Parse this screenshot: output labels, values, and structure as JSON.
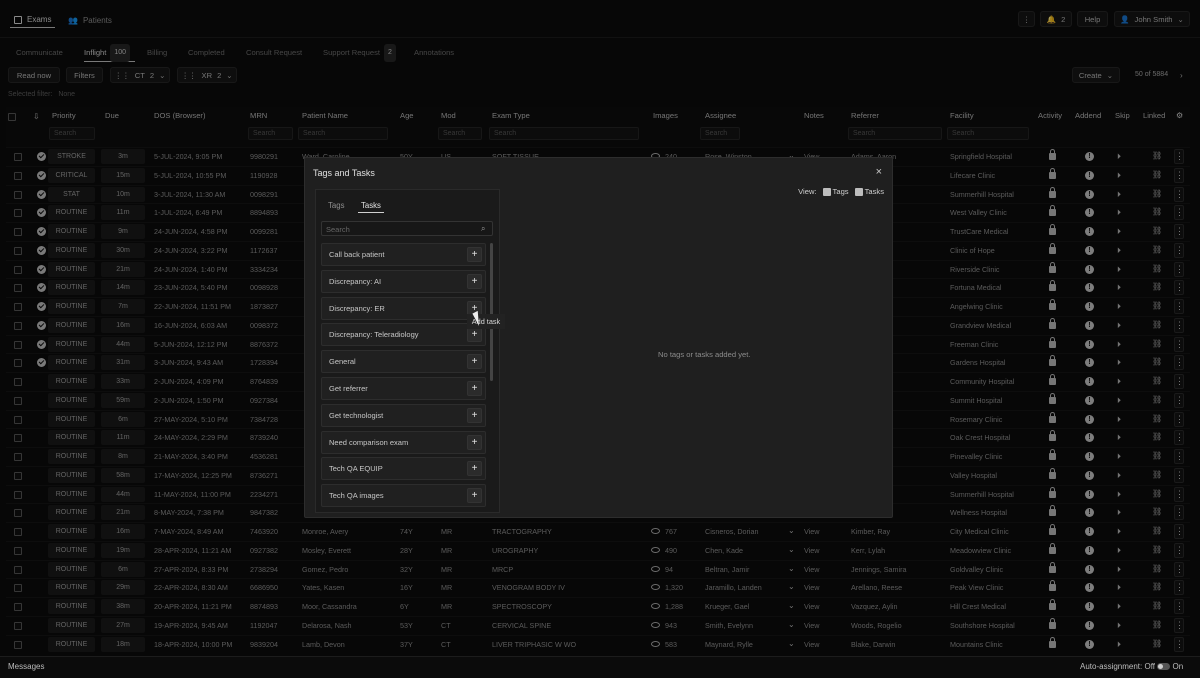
{
  "header": {
    "exams_label": "Exams",
    "patients_label": "Patients",
    "notifications_count": "2",
    "help_label": "Help",
    "user_label": "John Smith"
  },
  "subtabs": [
    {
      "label": "Communicate"
    },
    {
      "label": "Inflight",
      "count": "100"
    },
    {
      "label": "Billing"
    },
    {
      "label": "Completed"
    },
    {
      "label": "Consult Request"
    },
    {
      "label": "Support Request",
      "count": "2"
    },
    {
      "label": "Annotations"
    }
  ],
  "toolbar": {
    "read_now": "Read now",
    "filters": "Filters",
    "ct_label": "CT",
    "ct_count": "2",
    "xr_label": "XR",
    "xr_count": "2",
    "selected_filter_label": "Selected filter:",
    "selected_filter_value": "None",
    "create_label": "Create",
    "pagination": "50 of 5884"
  },
  "columns": [
    "Priority",
    "Due",
    "DOS (Browser)",
    "MRN",
    "Patient Name",
    "Age",
    "Mod",
    "Exam Type",
    "Images",
    "Assignee",
    "Notes",
    "Referrer",
    "Facility",
    "Activity",
    "Addend",
    "Skip",
    "Linked"
  ],
  "search_placeholder": "Search",
  "rows": [
    {
      "priority": "STROKE",
      "due": "3m",
      "dos": "5-JUL-2024, 9:05 PM",
      "mrn": "9980291",
      "patient": "Ward, Caroline",
      "age": "50Y",
      "mod": "US",
      "exam": "SOFT TISSUE",
      "images": "240",
      "assignee": "Rose, Winston",
      "notes": "View",
      "referrer": "Adams, Aaron",
      "facility": "Springfield Hospital",
      "done": true
    },
    {
      "priority": "CRITICAL",
      "due": "15m",
      "dos": "5-JUL-2024, 10:55 PM",
      "mrn": "1190928",
      "patient": "",
      "age": "",
      "mod": "",
      "exam": "",
      "images": "",
      "assignee": "",
      "notes": "",
      "referrer": "",
      "facility": "Lifecare Clinic",
      "done": true
    },
    {
      "priority": "STAT",
      "due": "10m",
      "dos": "3-JUL-2024, 11:30 AM",
      "mrn": "0098291",
      "patient": "",
      "age": "",
      "mod": "",
      "exam": "",
      "images": "",
      "assignee": "",
      "notes": "",
      "referrer": "ex",
      "facility": "Summerhill Hospital",
      "done": true
    },
    {
      "priority": "ROUTINE",
      "due": "11m",
      "dos": "1-JUL-2024, 6:49 PM",
      "mrn": "8894893",
      "patient": "",
      "age": "",
      "mod": "",
      "exam": "",
      "images": "",
      "assignee": "",
      "notes": "",
      "referrer": "ann",
      "facility": "West Valley Clinic",
      "done": true
    },
    {
      "priority": "ROUTINE",
      "due": "9m",
      "dos": "24-JUN-2024, 4:58 PM",
      "mrn": "0099281",
      "patient": "",
      "age": "",
      "mod": "",
      "exam": "",
      "images": "",
      "assignee": "",
      "notes": "",
      "referrer": "alani",
      "facility": "TrustCare Medical",
      "done": true
    },
    {
      "priority": "ROUTINE",
      "due": "30m",
      "dos": "24-JUN-2024, 3:22 PM",
      "mrn": "1172637",
      "patient": "",
      "age": "",
      "mod": "",
      "exam": "",
      "images": "",
      "assignee": "",
      "notes": "",
      "referrer": "ana",
      "facility": "Clinic of Hope",
      "done": true
    },
    {
      "priority": "ROUTINE",
      "due": "21m",
      "dos": "24-JUN-2024, 1:40 PM",
      "mrn": "3334234",
      "patient": "",
      "age": "",
      "mod": "",
      "exam": "",
      "images": "",
      "assignee": "",
      "notes": "",
      "referrer": "ate",
      "facility": "Riverside Clinic",
      "done": true
    },
    {
      "priority": "ROUTINE",
      "due": "14m",
      "dos": "23-JUN-2024, 5:40 PM",
      "mrn": "0098928",
      "patient": "",
      "age": "",
      "mod": "",
      "exam": "",
      "images": "",
      "assignee": "",
      "notes": "",
      "referrer": "",
      "facility": "Fortuna Medical",
      "done": true
    },
    {
      "priority": "ROUTINE",
      "due": "7m",
      "dos": "22-JUN-2024, 11:51 PM",
      "mrn": "1873827",
      "patient": "",
      "age": "",
      "mod": "",
      "exam": "",
      "images": "",
      "assignee": "",
      "notes": "",
      "referrer": "o",
      "facility": "Angelwing Clinic",
      "done": true
    },
    {
      "priority": "ROUTINE",
      "due": "16m",
      "dos": "16-JUN-2024, 6:03 AM",
      "mrn": "0098372",
      "patient": "",
      "age": "",
      "mod": "",
      "exam": "",
      "images": "",
      "assignee": "",
      "notes": "",
      "referrer": "",
      "facility": "Grandview Medical",
      "done": true
    },
    {
      "priority": "ROUTINE",
      "due": "44m",
      "dos": "5-JUN-2024, 12:12 PM",
      "mrn": "8876372",
      "patient": "",
      "age": "",
      "mod": "",
      "exam": "",
      "images": "",
      "assignee": "",
      "notes": "",
      "referrer": "emis",
      "facility": "Freeman Clinic",
      "done": true
    },
    {
      "priority": "ROUTINE",
      "due": "31m",
      "dos": "3-JUN-2024, 9:43 AM",
      "mrn": "1728394",
      "patient": "",
      "age": "",
      "mod": "",
      "exam": "",
      "images": "",
      "assignee": "",
      "notes": "",
      "referrer": "ha",
      "facility": "Gardens Hospital",
      "done": true
    },
    {
      "priority": "ROUTINE",
      "due": "33m",
      "dos": "2-JUN-2024, 4:09 PM",
      "mrn": "8764839",
      "patient": "",
      "age": "",
      "mod": "",
      "exam": "",
      "images": "",
      "assignee": "",
      "notes": "",
      "referrer": "",
      "facility": "Community Hospital",
      "done": false
    },
    {
      "priority": "ROUTINE",
      "due": "59m",
      "dos": "2-JUN-2024, 1:50 PM",
      "mrn": "0927384",
      "patient": "",
      "age": "",
      "mod": "",
      "exam": "",
      "images": "",
      "assignee": "",
      "notes": "",
      "referrer": "ensen",
      "facility": "Summit Hospital",
      "done": false
    },
    {
      "priority": "ROUTINE",
      "due": "6m",
      "dos": "27-MAY-2024, 5:10 PM",
      "mrn": "7384728",
      "patient": "",
      "age": "",
      "mod": "",
      "exam": "",
      "images": "",
      "assignee": "",
      "notes": "",
      "referrer": "n",
      "facility": "Rosemary Clinic",
      "done": false
    },
    {
      "priority": "ROUTINE",
      "due": "11m",
      "dos": "24-MAY-2024, 2:29 PM",
      "mrn": "8739240",
      "patient": "",
      "age": "",
      "mod": "",
      "exam": "",
      "images": "",
      "assignee": "",
      "notes": "",
      "referrer": "ton",
      "facility": "Oak Crest Hospital",
      "done": false
    },
    {
      "priority": "ROUTINE",
      "due": "8m",
      "dos": "21-MAY-2024, 3:40 PM",
      "mrn": "4536281",
      "patient": "",
      "age": "",
      "mod": "",
      "exam": "",
      "images": "",
      "assignee": "",
      "notes": "",
      "referrer": "elio",
      "facility": "Pinevalley Clinic",
      "done": false
    },
    {
      "priority": "ROUTINE",
      "due": "58m",
      "dos": "17-MAY-2024, 12:25 PM",
      "mrn": "8736271",
      "patient": "",
      "age": "",
      "mod": "",
      "exam": "",
      "images": "",
      "assignee": "",
      "notes": "",
      "referrer": "Joel",
      "facility": "Valley Hospital",
      "done": false
    },
    {
      "priority": "ROUTINE",
      "due": "44m",
      "dos": "11-MAY-2024, 11:00 PM",
      "mrn": "2234271",
      "patient": "",
      "age": "",
      "mod": "",
      "exam": "",
      "images": "",
      "assignee": "",
      "notes": "",
      "referrer": "",
      "facility": "Summerhill Hospital",
      "done": false
    },
    {
      "priority": "ROUTINE",
      "due": "21m",
      "dos": "8-MAY-2024, 7:38 PM",
      "mrn": "9847382",
      "patient": "",
      "age": "",
      "mod": "",
      "exam": "",
      "images": "",
      "assignee": "",
      "notes": "",
      "referrer": "",
      "facility": "Wellness Hospital",
      "done": false
    },
    {
      "priority": "ROUTINE",
      "due": "16m",
      "dos": "7-MAY-2024, 8:49 AM",
      "mrn": "7463920",
      "patient": "Monroe, Avery",
      "age": "74Y",
      "mod": "MR",
      "exam": "TRACTOGRAPHY",
      "images": "767",
      "assignee": "Cisneros, Dorian",
      "notes": "View",
      "referrer": "Kimber, Ray",
      "facility": "City Medical Clinic",
      "done": false
    },
    {
      "priority": "ROUTINE",
      "due": "19m",
      "dos": "28-APR-2024, 11:21 AM",
      "mrn": "0927382",
      "patient": "Mosley, Everett",
      "age": "28Y",
      "mod": "MR",
      "exam": "UROGRAPHY",
      "images": "490",
      "assignee": "Chen, Kade",
      "notes": "View",
      "referrer": "Kerr, Lylah",
      "facility": "Meadowview Clinic",
      "done": false
    },
    {
      "priority": "ROUTINE",
      "due": "6m",
      "dos": "27-APR-2024, 8:33 PM",
      "mrn": "2738294",
      "patient": "Gomez, Pedro",
      "age": "32Y",
      "mod": "MR",
      "exam": "MRCP",
      "images": "94",
      "assignee": "Beltran, Jamir",
      "notes": "View",
      "referrer": "Jennings, Samira",
      "facility": "Goldvalley Clinic",
      "done": false
    },
    {
      "priority": "ROUTINE",
      "due": "29m",
      "dos": "22-APR-2024, 8:30 AM",
      "mrn": "6686950",
      "patient": "Yates, Kasen",
      "age": "16Y",
      "mod": "MR",
      "exam": "VENOGRAM BODY IV",
      "images": "1,320",
      "assignee": "Jaramillo, Landen",
      "notes": "View",
      "referrer": "Arellano, Reese",
      "facility": "Peak View Clinic",
      "done": false
    },
    {
      "priority": "ROUTINE",
      "due": "38m",
      "dos": "20-APR-2024, 11:21 PM",
      "mrn": "8874893",
      "patient": "Moor, Cassandra",
      "age": "6Y",
      "mod": "MR",
      "exam": "SPECTROSCOPY",
      "images": "1,288",
      "assignee": "Krueger, Gael",
      "notes": "View",
      "referrer": "Vazquez, Aylin",
      "facility": "Hill Crest Medical",
      "done": false
    },
    {
      "priority": "ROUTINE",
      "due": "27m",
      "dos": "19-APR-2024, 9:45 AM",
      "mrn": "1192047",
      "patient": "Delarosa, Nash",
      "age": "53Y",
      "mod": "CT",
      "exam": "CERVICAL SPINE",
      "images": "943",
      "assignee": "Smith, Evelynn",
      "notes": "View",
      "referrer": "Woods, Rogelio",
      "facility": "Southshore Hospital",
      "done": false
    },
    {
      "priority": "ROUTINE",
      "due": "18m",
      "dos": "18-APR-2024, 10:00 PM",
      "mrn": "9839204",
      "patient": "Lamb, Devon",
      "age": "37Y",
      "mod": "CT",
      "exam": "LIVER TRIPHASIC W WO",
      "images": "583",
      "assignee": "Maynard, Rylle",
      "notes": "View",
      "referrer": "Blake, Darwin",
      "facility": "Mountains Clinic",
      "done": false
    }
  ],
  "modal": {
    "title": "Tags and Tasks",
    "view_label": "View:",
    "tags_label": "Tags",
    "tasks_label": "Tasks",
    "tab_tags": "Tags",
    "tab_tasks": "Tasks",
    "search_placeholder": "Search",
    "empty_text": "No tags or tasks added yet.",
    "tooltip": "Add task",
    "tasks": [
      "Call back patient",
      "Discrepancy: AI",
      "Discrepancy: ER",
      "Discrepancy: Teleradiology",
      "General",
      "Get referrer",
      "Get technologist",
      "Need comparison exam",
      "Tech QA EQUIP",
      "Tech QA images"
    ]
  },
  "footer": {
    "messages": "Messages",
    "auto_assignment": "Auto-assignment:",
    "off": "Off",
    "on": "On"
  }
}
